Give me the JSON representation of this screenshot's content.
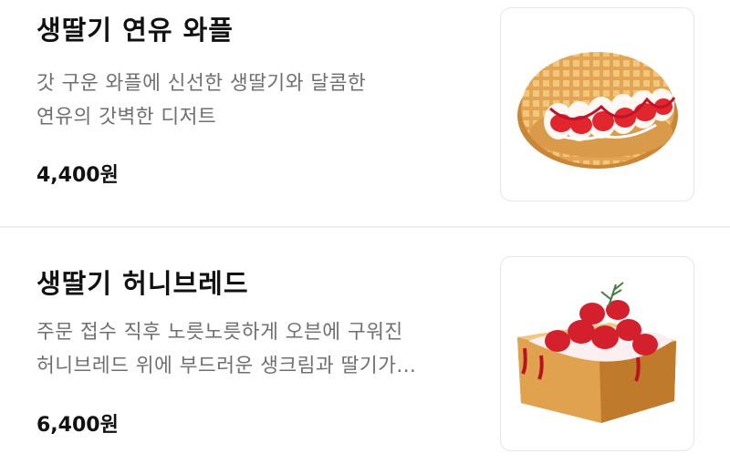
{
  "menu": {
    "items": [
      {
        "name": "생딸기 연유 와플",
        "desc_lines": [
          "갓 구운 와플에 신선한 생딸기와 달콤한",
          "연유의 갓벽한 디저트"
        ],
        "price": "4,400원",
        "image_icon": "strawberry-waffle-image"
      },
      {
        "name": "생딸기 허니브레드",
        "desc_lines": [
          "주문 접수 직후 노릇노릇하게 오븐에 구워진",
          "허니브레드 위에 부드러운 생크림과 딸기가..."
        ],
        "price": "6,400원",
        "image_icon": "strawberry-honey-bread-image"
      }
    ]
  },
  "colors": {
    "text_primary": "#111111",
    "text_secondary": "#6f6f6f",
    "divider": "#eeeeee",
    "card_border": "#e6e6e6"
  }
}
